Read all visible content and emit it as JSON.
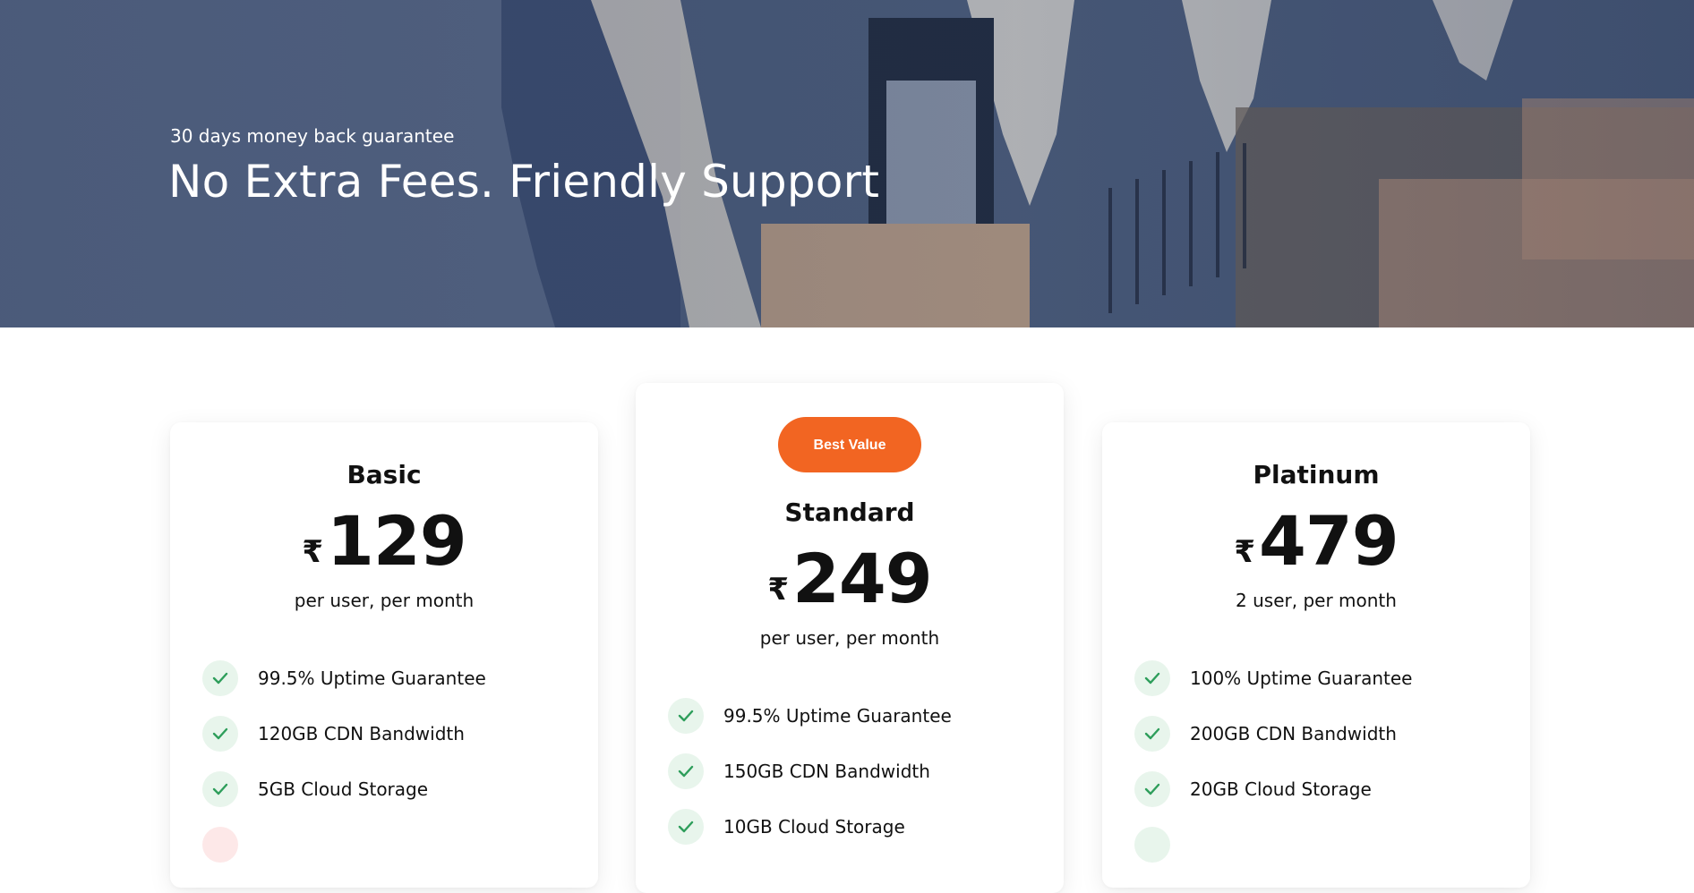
{
  "hero": {
    "eyebrow": "30 days money back guarantee",
    "title": "No Extra Fees. Friendly Support"
  },
  "colors": {
    "accent": "#f26522",
    "check": "#2e9e5b",
    "check_bg": "#e8f5ec"
  },
  "plans": [
    {
      "name": "Basic",
      "currency": "₹",
      "price": "129",
      "period": "per user, per month",
      "features": [
        {
          "label": "99.5% Uptime Guarantee",
          "icon": "check-icon"
        },
        {
          "label": "120GB CDN Bandwidth",
          "icon": "check-icon"
        },
        {
          "label": "5GB Cloud Storage",
          "icon": "check-icon"
        }
      ]
    },
    {
      "badge": "Best Value",
      "name": "Standard",
      "currency": "₹",
      "price": "249",
      "period": "per user, per month",
      "features": [
        {
          "label": "99.5% Uptime Guarantee",
          "icon": "check-icon"
        },
        {
          "label": "150GB CDN Bandwidth",
          "icon": "check-icon"
        },
        {
          "label": "10GB Cloud Storage",
          "icon": "check-icon"
        }
      ]
    },
    {
      "name": "Platinum",
      "currency": "₹",
      "price": "479",
      "period": "2 user, per month",
      "features": [
        {
          "label": "100% Uptime Guarantee",
          "icon": "check-icon"
        },
        {
          "label": "200GB CDN Bandwidth",
          "icon": "check-icon"
        },
        {
          "label": "20GB Cloud Storage",
          "icon": "check-icon"
        }
      ]
    }
  ]
}
